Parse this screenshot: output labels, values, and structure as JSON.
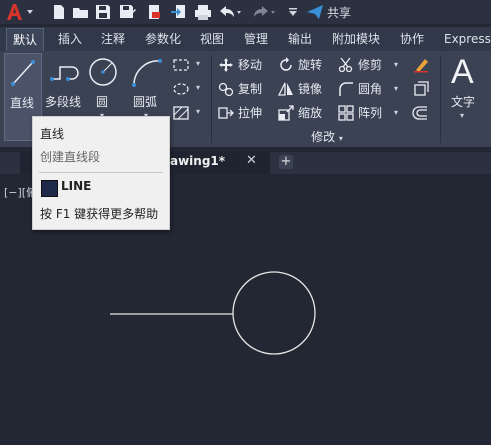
{
  "quick_access": {
    "share_label": "共享",
    "icons": [
      "app-menu-icon",
      "new-icon",
      "open-icon",
      "save-icon",
      "save-as-icon",
      "save-to-web-icon",
      "import-icon",
      "export-icon",
      "plot-icon",
      "undo-icon",
      "redo-icon",
      "customize-icon"
    ]
  },
  "ribbon_tabs": [
    "默认",
    "插入",
    "注释",
    "参数化",
    "视图",
    "管理",
    "输出",
    "附加模块",
    "协作",
    "Express"
  ],
  "active_tab": "默认",
  "draw_panel": {
    "line": "直线",
    "polyline": "多段线",
    "circle": "圆",
    "arc": "圆弧"
  },
  "modify_panel": {
    "title": "修改",
    "move": "移动",
    "rotate": "旋转",
    "trim": "修剪",
    "copy": "复制",
    "mirror": "镜像",
    "fillet": "圆角",
    "stretch": "拉伸",
    "scale": "缩放",
    "array": "阵列"
  },
  "annotation_panel": {
    "text_label": "文字",
    "text_glyph": "A"
  },
  "document_tab": {
    "title": "awing1*",
    "close": "✕",
    "new_tab": "+"
  },
  "viewport_label": "[−][俯",
  "tooltip": {
    "title": "直线",
    "description": "创建直线段",
    "command": "LINE",
    "help": "按 F1 键获得更多帮助"
  },
  "colors": {
    "background": "#222733",
    "ribbon": "#3b4253",
    "accent_red": "#d9342b",
    "share_blue": "#3a8fd9"
  }
}
